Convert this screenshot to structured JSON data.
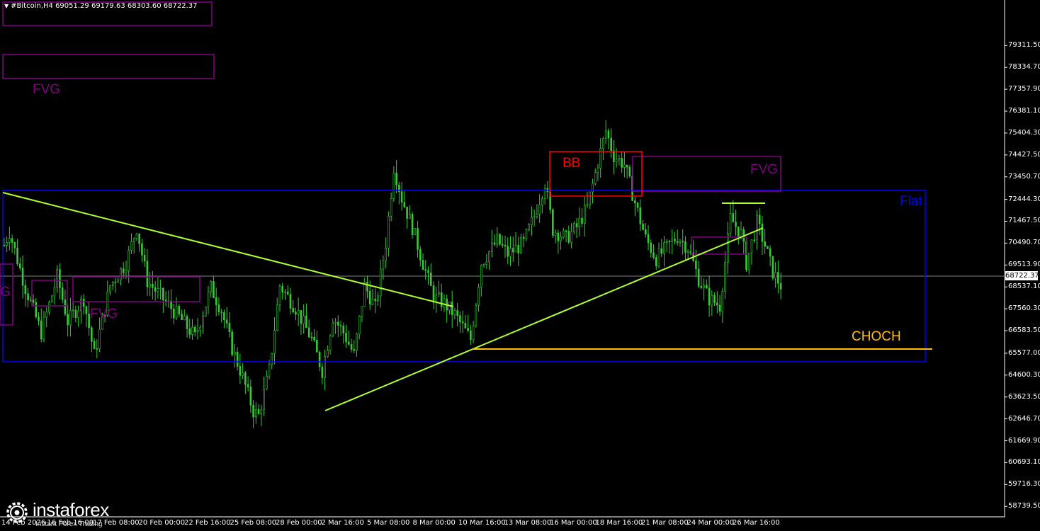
{
  "header": {
    "symbol_line": "#Bitcoin,H4  69051.29 69179.63 68303.60 68722.37"
  },
  "current_price_label": "68722.37",
  "watermark": {
    "brand": "instaforex",
    "tagline": "Instant Forex Trading"
  },
  "colors": {
    "background": "#000000",
    "candles": "#32cd32",
    "trendline": "#adff2f",
    "flat_box": "#0000ff",
    "fvg": "#800080",
    "bb": "#ff0000",
    "choch": "#ffc000",
    "axis": "#ffffff",
    "price_line": "#808080"
  },
  "annotations": [
    {
      "id": "fvg-top",
      "label": "FVG",
      "color": "#800080"
    },
    {
      "id": "fvg-left",
      "label": "G",
      "color": "#800080"
    },
    {
      "id": "fvg-mid",
      "label": "FVG",
      "color": "#800080"
    },
    {
      "id": "bb",
      "label": "BB",
      "color": "#ff0000"
    },
    {
      "id": "fvg-right",
      "label": "FVG",
      "color": "#800080"
    },
    {
      "id": "flat",
      "label": "Flat",
      "color": "#0000ff"
    },
    {
      "id": "choch",
      "label": "CHOCH",
      "color": "#ffc000"
    }
  ],
  "chart_data": {
    "type": "candlestick",
    "symbol": "#Bitcoin",
    "timeframe": "H4",
    "last_bar": {
      "open": 69051.29,
      "high": 69179.63,
      "low": 68303.6,
      "close": 68722.37
    },
    "ylim": [
      58400,
      80300
    ],
    "y_ticks": [
      "79311.50",
      "78334.70",
      "77357.90",
      "76381.10",
      "75404.30",
      "74427.50",
      "73450.70",
      "72444.30",
      "71467.50",
      "70490.70",
      "69513.90",
      "68537.10",
      "67560.30",
      "66583.50",
      "65577.00",
      "64600.30",
      "63623.50",
      "62646.70",
      "61669.90",
      "60693.10",
      "59716.30",
      "58739.50"
    ],
    "x_ticks": [
      "14 Feb 2026",
      "16 Feb 16:00",
      "17 Feb 08:00",
      "20 Feb 00:00",
      "22 Feb 16:00",
      "25 Feb 08:00",
      "28 Feb 00:00",
      "2 Mar 16:00",
      "5 Mar 08:00",
      "8 Mar 00:00",
      "10 Mar 16:00",
      "13 Mar 08:00",
      "16 Mar 00:00",
      "18 Mar 16:00",
      "21 Mar 08:00",
      "24 Mar 00:00",
      "26 Mar 16:00"
    ],
    "price_path": [
      {
        "t": 0,
        "p": 70400
      },
      {
        "t": 2,
        "p": 71000
      },
      {
        "t": 8,
        "p": 68500
      },
      {
        "t": 14,
        "p": 66500
      },
      {
        "t": 20,
        "p": 69000
      },
      {
        "t": 24,
        "p": 67000
      },
      {
        "t": 30,
        "p": 68000
      },
      {
        "t": 34,
        "p": 65500
      },
      {
        "t": 40,
        "p": 68600
      },
      {
        "t": 46,
        "p": 69600
      },
      {
        "t": 50,
        "p": 71200
      },
      {
        "t": 54,
        "p": 68800
      },
      {
        "t": 60,
        "p": 68000
      },
      {
        "t": 66,
        "p": 67200
      },
      {
        "t": 72,
        "p": 66300
      },
      {
        "t": 78,
        "p": 68500
      },
      {
        "t": 82,
        "p": 67500
      },
      {
        "t": 86,
        "p": 65800
      },
      {
        "t": 90,
        "p": 64500
      },
      {
        "t": 94,
        "p": 63000
      },
      {
        "t": 96,
        "p": 62800
      },
      {
        "t": 100,
        "p": 64800
      },
      {
        "t": 104,
        "p": 68600
      },
      {
        "t": 110,
        "p": 67600
      },
      {
        "t": 116,
        "p": 66200
      },
      {
        "t": 120,
        "p": 64800
      },
      {
        "t": 124,
        "p": 67200
      },
      {
        "t": 128,
        "p": 66500
      },
      {
        "t": 132,
        "p": 65500
      },
      {
        "t": 136,
        "p": 68600
      },
      {
        "t": 140,
        "p": 67600
      },
      {
        "t": 144,
        "p": 70500
      },
      {
        "t": 147,
        "p": 73900
      },
      {
        "t": 150,
        "p": 72500
      },
      {
        "t": 154,
        "p": 71200
      },
      {
        "t": 158,
        "p": 69600
      },
      {
        "t": 162,
        "p": 68100
      },
      {
        "t": 166,
        "p": 67800
      },
      {
        "t": 170,
        "p": 67300
      },
      {
        "t": 176,
        "p": 66200
      },
      {
        "t": 180,
        "p": 69600
      },
      {
        "t": 186,
        "p": 70600
      },
      {
        "t": 190,
        "p": 70000
      },
      {
        "t": 196,
        "p": 70500
      },
      {
        "t": 200,
        "p": 71700
      },
      {
        "t": 204,
        "p": 73200
      },
      {
        "t": 207,
        "p": 71100
      },
      {
        "t": 212,
        "p": 70700
      },
      {
        "t": 216,
        "p": 71200
      },
      {
        "t": 220,
        "p": 72100
      },
      {
        "t": 224,
        "p": 74100
      },
      {
        "t": 227,
        "p": 75500
      },
      {
        "t": 230,
        "p": 74400
      },
      {
        "t": 234,
        "p": 74000
      },
      {
        "t": 238,
        "p": 72300
      },
      {
        "t": 242,
        "p": 70700
      },
      {
        "t": 246,
        "p": 69800
      },
      {
        "t": 250,
        "p": 70300
      },
      {
        "t": 254,
        "p": 70800
      },
      {
        "t": 258,
        "p": 70300
      },
      {
        "t": 262,
        "p": 68900
      },
      {
        "t": 266,
        "p": 68000
      },
      {
        "t": 270,
        "p": 67700
      },
      {
        "t": 274,
        "p": 71600
      },
      {
        "t": 278,
        "p": 70900
      },
      {
        "t": 280,
        "p": 69600
      },
      {
        "t": 284,
        "p": 71400
      },
      {
        "t": 287,
        "p": 70400
      },
      {
        "t": 290,
        "p": 69200
      },
      {
        "t": 293,
        "p": 68600
      }
    ]
  }
}
